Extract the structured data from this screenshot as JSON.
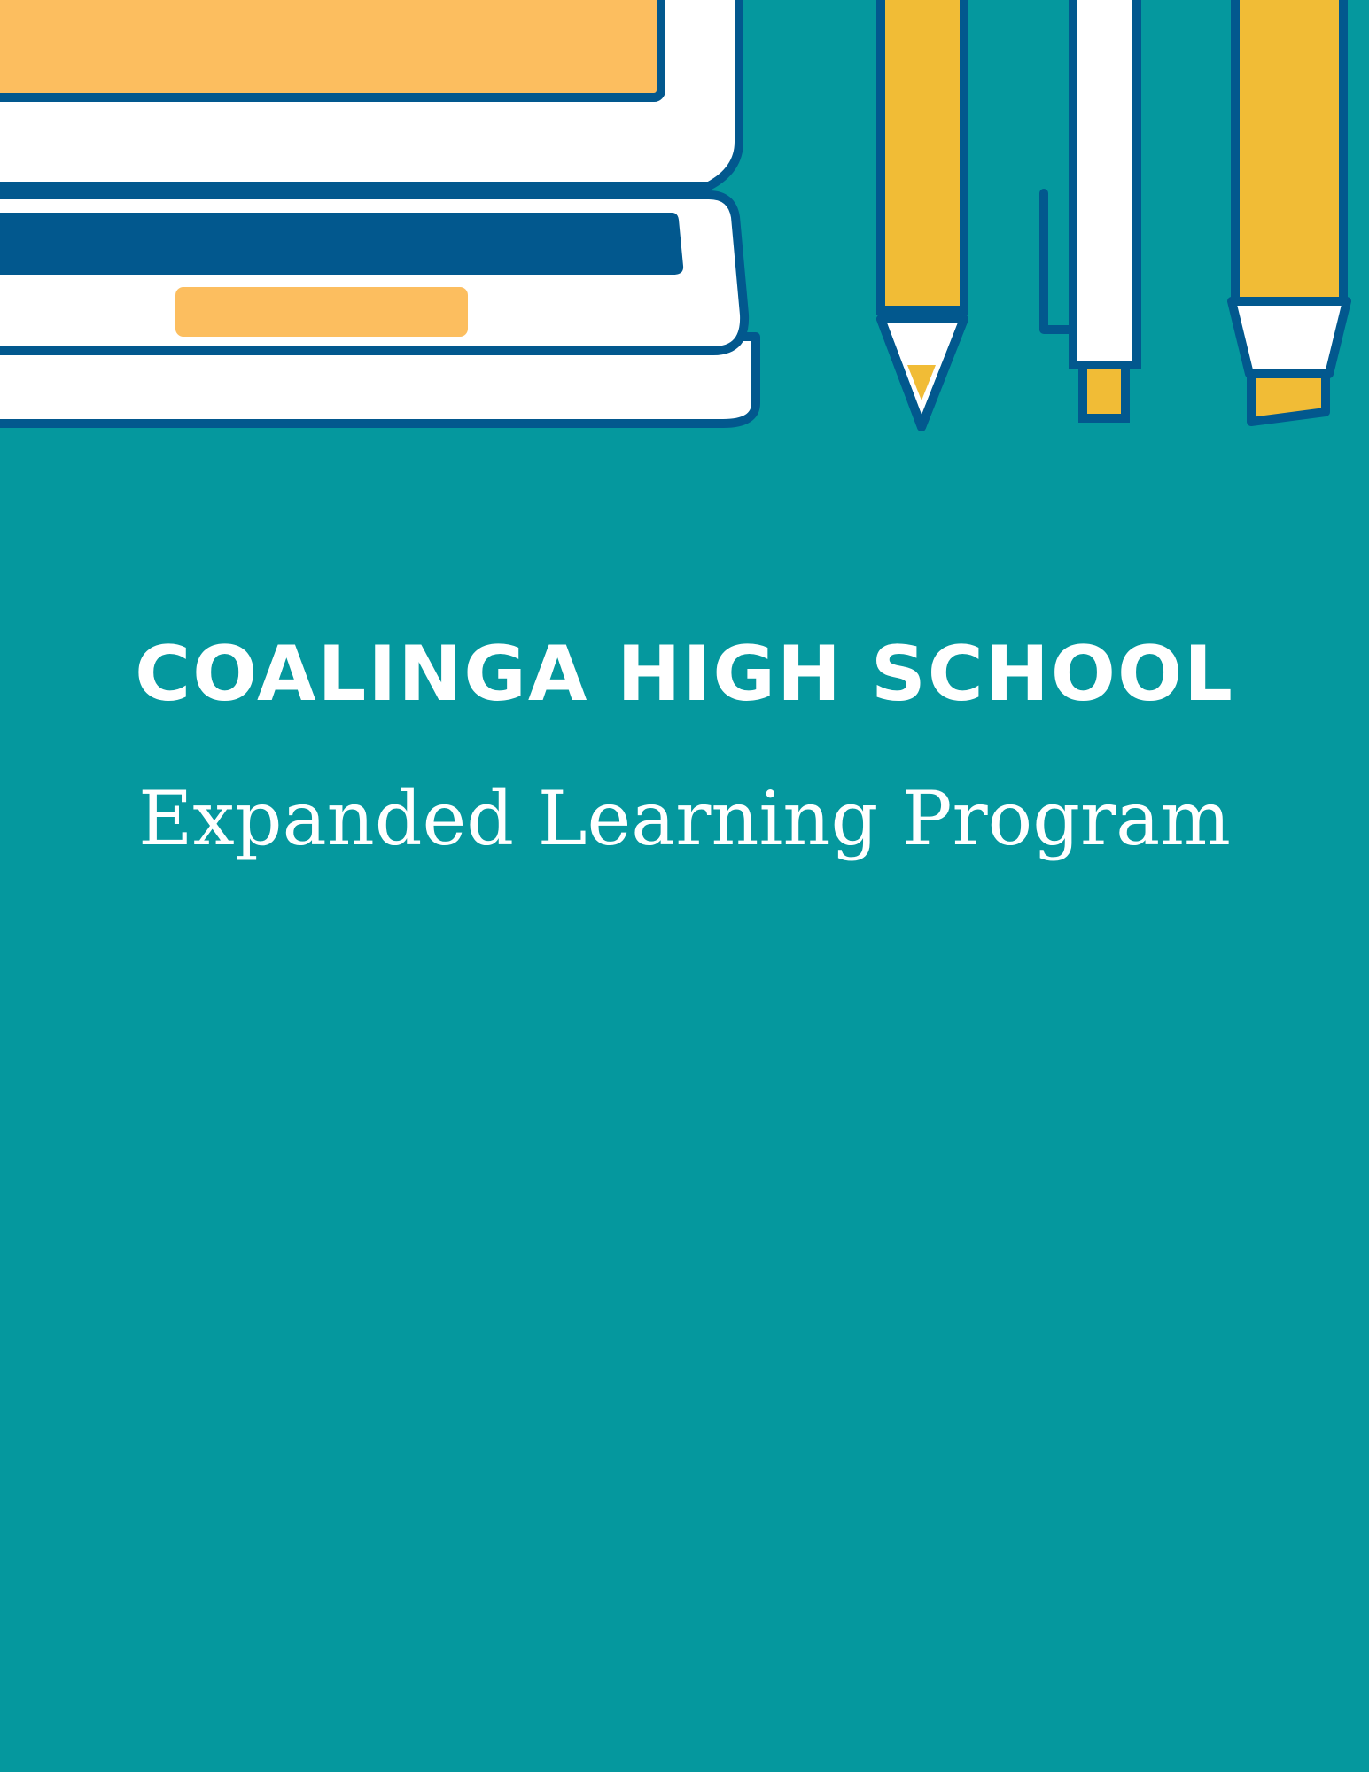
{
  "cover": {
    "title": "COALINGA HIGH SCHOOL",
    "subtitle": "Expanded Learning Program"
  },
  "colors": {
    "background": "#05989e",
    "outline": "#02588e",
    "yellow": "#f1bc36",
    "orange": "#fcbe5f",
    "white": "#ffffff",
    "text": "#ffffff"
  },
  "icons": [
    "laptop-icon",
    "pencil-icon",
    "pen-icon",
    "marker-icon"
  ]
}
